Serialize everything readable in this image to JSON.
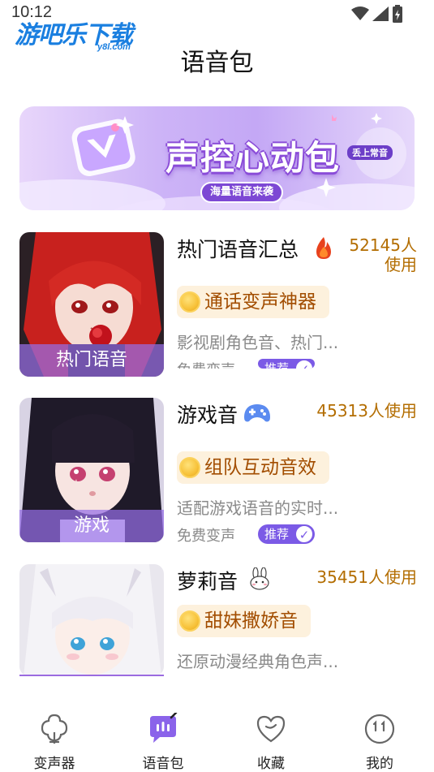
{
  "status_bar": {
    "time": "10:12",
    "icons": [
      "wifi-icon",
      "signal-icon",
      "battery-icon"
    ]
  },
  "watermark": {
    "main": "游吧乐下载",
    "sub": "y8l.com"
  },
  "page": {
    "title": "语音包"
  },
  "banner": {
    "title": "声控心动包",
    "subtitle": "海量语音来袭",
    "badge": "丢上常音"
  },
  "colors": {
    "accent_purple": "#7b5ae6",
    "tag_bg": "#fdf1dd",
    "tag_text": "#a24d00",
    "users_text": "#b36d00",
    "desc_text": "#8a8a8a"
  },
  "items": [
    {
      "thumb_label": "热门语音",
      "title": "热门语音汇总",
      "title_icon": "fire-icon",
      "users": "52145人\n使用",
      "users_line1": "52145人",
      "users_line2": "使用",
      "tag": "通话变声神器",
      "desc": "影视剧角色音、热门...",
      "meta": "免费变声",
      "recommend": "推荐"
    },
    {
      "thumb_label": "游戏",
      "title": "游戏音",
      "title_icon": "gamepad-icon",
      "users": "45313人使用",
      "tag": "组队互动音效",
      "desc": "适配游戏语音的实时...",
      "meta": "免费变声",
      "recommend": "推荐"
    },
    {
      "thumb_label": "",
      "title": "萝莉音",
      "title_icon": "bunny-icon",
      "users": "35451人使用",
      "tag": "甜妹撒娇音",
      "desc": "还原动漫经典角色声..."
    }
  ],
  "nav": [
    {
      "label": "变声器",
      "icon": "voice-changer-icon",
      "active": false
    },
    {
      "label": "语音包",
      "icon": "voice-pack-icon",
      "active": true
    },
    {
      "label": "收藏",
      "icon": "heart-icon",
      "active": false
    },
    {
      "label": "我的",
      "icon": "profile-icon",
      "active": false
    }
  ]
}
